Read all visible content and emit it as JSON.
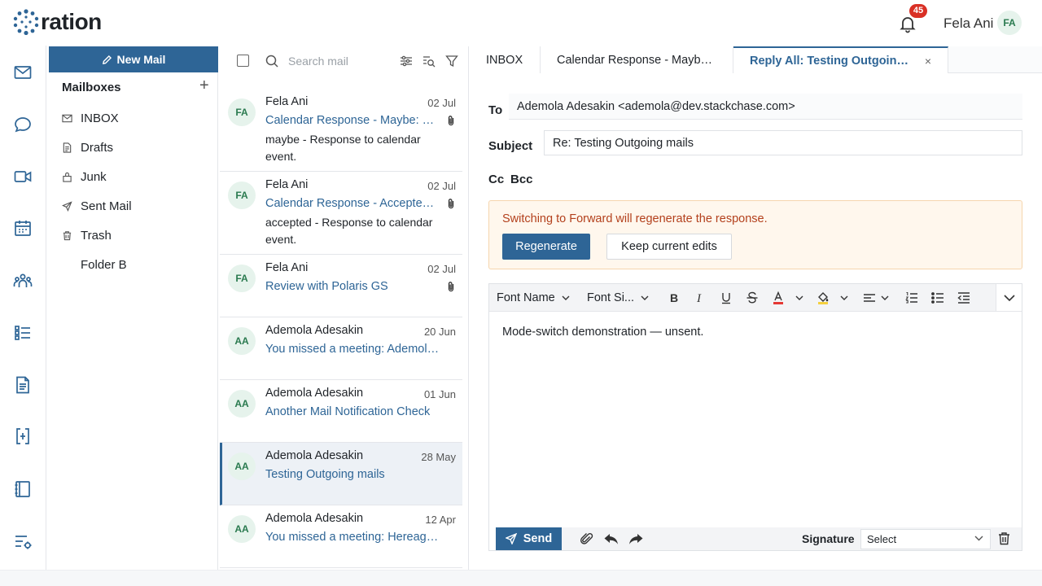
{
  "app": {
    "logo_text": "ration"
  },
  "header": {
    "notification_count": "45",
    "user_name": "Fela Ani",
    "user_initials": "FA"
  },
  "rail": {
    "icons": [
      "mail-icon",
      "chat-icon",
      "video-icon",
      "calendar-icon",
      "people-icon",
      "tasks-icon",
      "document-icon",
      "workflow-icon",
      "notebook-icon",
      "settings-list-icon"
    ]
  },
  "mailboxes": {
    "new_mail_label": "New Mail",
    "title": "Mailboxes",
    "add_label": "+",
    "items": [
      {
        "label": "INBOX",
        "icon": "mail-icon"
      },
      {
        "label": "Drafts",
        "icon": "draft-icon"
      },
      {
        "label": "Junk",
        "icon": "junk-icon"
      },
      {
        "label": "Sent Mail",
        "icon": "send-icon"
      },
      {
        "label": "Trash",
        "icon": "trash-icon"
      },
      {
        "label": "Folder B",
        "icon": ""
      }
    ]
  },
  "list": {
    "search_placeholder": "Search mail",
    "mails": [
      {
        "initials": "FA",
        "from": "Fela Ani",
        "date": "02 Jul",
        "subject": "Calendar Response - Maybe: Re: Testing",
        "preview": "maybe - Response to calendar event.",
        "attachment": true
      },
      {
        "initials": "FA",
        "from": "Fela Ani",
        "date": "02 Jul",
        "subject": "Calendar Response - Accepted: Re: Testing",
        "preview": "accepted - Response to calendar event.",
        "attachment": true
      },
      {
        "initials": "FA",
        "from": "Fela Ani",
        "date": "02 Jul",
        "subject": "Review with Polaris GS",
        "preview": "",
        "attachment": true
      },
      {
        "initials": "AA",
        "from": "Ademola Adesakin",
        "date": "20 Jun",
        "subject": "You missed a meeting: Ademola's meeting",
        "preview": "",
        "attachment": false
      },
      {
        "initials": "AA",
        "from": "Ademola Adesakin",
        "date": "01 Jun",
        "subject": "Another Mail Notification Check",
        "preview": "",
        "attachment": false
      },
      {
        "initials": "AA",
        "from": "Ademola Adesakin",
        "date": "28 May",
        "subject": "Testing Outgoing mails",
        "preview": "",
        "attachment": false
      },
      {
        "initials": "AA",
        "from": "Ademola Adesakin",
        "date": "12 Apr",
        "subject": "You missed a meeting: Hereagain",
        "preview": "",
        "attachment": false
      }
    ]
  },
  "tabs": [
    {
      "label": "INBOX",
      "active": false
    },
    {
      "label": "Calendar Response - Maybe: Re: Testing",
      "active": false
    },
    {
      "label": "Reply All: Testing Outgoing mails",
      "active": true,
      "close": "×"
    }
  ],
  "compose": {
    "to_label": "To",
    "to_value": "Ademola Adesakin <ademola@dev.stackchase.com>",
    "subject_label": "Subject",
    "subject_value": "Re: Testing Outgoing mails",
    "cc_label": "Cc",
    "bcc_label": "Bcc",
    "notice_text": "Switching to Forward will regenerate the response.",
    "regenerate_label": "Regenerate",
    "keep_label": "Keep current edits",
    "font_name_label": "Font Name",
    "font_size_label": "Font Si...",
    "body_text": "Mode-switch demonstration — unsent.",
    "send_label": "Send",
    "signature_label": "Signature",
    "signature_value": "Select"
  },
  "colors": {
    "primary": "#2e6596",
    "notice_bg": "#fff7ed",
    "notice_text": "#b3401c",
    "badge": "#d93025",
    "avatar_bg": "#e6f3ec"
  }
}
